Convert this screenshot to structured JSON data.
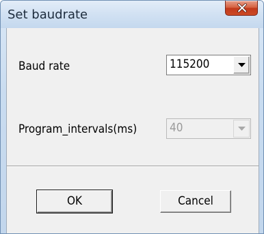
{
  "window": {
    "title": "Set baudrate",
    "close_icon": "close-x-icon"
  },
  "form": {
    "baud_rate": {
      "label": "Baud rate",
      "value": "115200",
      "enabled": true
    },
    "program_intervals": {
      "label": "Program_intervals(ms)",
      "value": "40",
      "enabled": false
    }
  },
  "buttons": {
    "ok_label": "OK",
    "cancel_label": "Cancel"
  },
  "colors": {
    "title_bar": "#c9dcf0",
    "client_background": "#f0f0f0",
    "close_button": "#c1391b",
    "disabled_text": "#9a9a9a"
  }
}
